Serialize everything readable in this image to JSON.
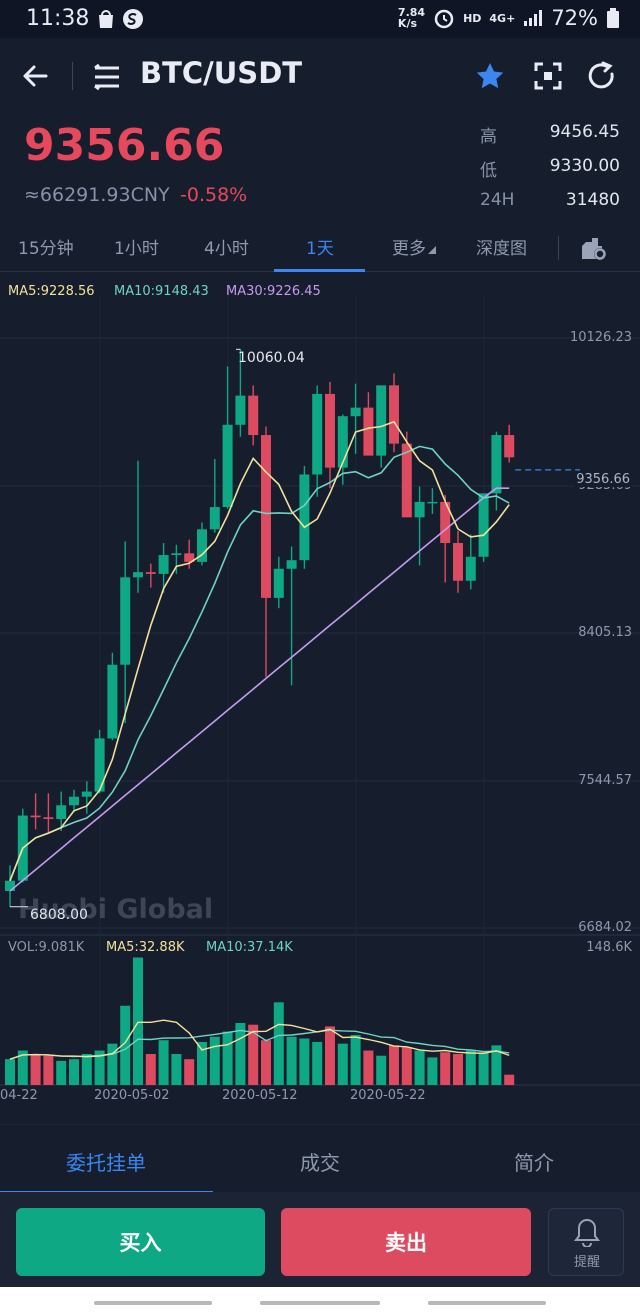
{
  "status": {
    "time": "11:38",
    "net_speed_top": "7.84",
    "net_speed_bot": "K/s",
    "hd": "HD",
    "net_type": "4G+",
    "battery": "72%"
  },
  "nav": {
    "title": "BTC/USDT"
  },
  "price": {
    "last": "9356.66",
    "cny": "≈66291.93CNY",
    "change": "-0.58%",
    "high_label": "高",
    "high": "9456.45",
    "low_label": "低",
    "low": "9330.00",
    "vol_label": "24H",
    "vol": "31480"
  },
  "tabs": [
    "15分钟",
    "1小时",
    "4小时",
    "1天",
    "更多",
    "深度图"
  ],
  "active_tab": "1天",
  "legend": {
    "ma5": "MA5:9228.56",
    "ma10": "MA10:9148.43",
    "ma30": "MA30:9226.45",
    "vol": "VOL:9.081K",
    "vma5": "MA5:32.88K",
    "vma10": "MA10:37.14K"
  },
  "axis": {
    "p1": "10126.23",
    "p2": "9285.69",
    "p3": "8405.13",
    "p4": "7544.57",
    "p5": "6684.02",
    "vmax": "148.6K",
    "price_tag": "9356.66",
    "hi_marker": "10060.04",
    "lo_marker": "6808.00"
  },
  "dates": [
    "04-22",
    "2020-05-02",
    "2020-05-12",
    "2020-05-22"
  ],
  "watermark": "Huobi Global",
  "colors": {
    "up": "#0fa884",
    "down": "#dc4b5f",
    "ma5": "#f1e19a",
    "ma10": "#6fd3c4",
    "ma30": "#c59af0",
    "accent": "#3b86ef"
  },
  "chart_data": {
    "type": "candlestick",
    "x": [
      "2020-04-20",
      "2020-04-21",
      "2020-04-22",
      "2020-04-23",
      "2020-04-24",
      "2020-04-25",
      "2020-04-26",
      "2020-04-27",
      "2020-04-28",
      "2020-04-29",
      "2020-04-30",
      "2020-05-01",
      "2020-05-02",
      "2020-05-03",
      "2020-05-04",
      "2020-05-05",
      "2020-05-06",
      "2020-05-07",
      "2020-05-08",
      "2020-05-09",
      "2020-05-10",
      "2020-05-11",
      "2020-05-12",
      "2020-05-13",
      "2020-05-14",
      "2020-05-15",
      "2020-05-16",
      "2020-05-17",
      "2020-05-18",
      "2020-05-19",
      "2020-05-20",
      "2020-05-21",
      "2020-05-22",
      "2020-05-23",
      "2020-05-24",
      "2020-05-25",
      "2020-05-26",
      "2020-05-27",
      "2020-05-28",
      "2020-05-29"
    ],
    "ohlc": [
      [
        6900,
        7050,
        6808,
        6960
      ],
      [
        6960,
        7380,
        6950,
        7340
      ],
      [
        7340,
        7470,
        7260,
        7330
      ],
      [
        7330,
        7470,
        7240,
        7320
      ],
      [
        7320,
        7480,
        7250,
        7400
      ],
      [
        7400,
        7490,
        7360,
        7450
      ],
      [
        7450,
        7540,
        7350,
        7480
      ],
      [
        7480,
        7840,
        7470,
        7790
      ],
      [
        7790,
        8290,
        7780,
        8220
      ],
      [
        8220,
        8940,
        7880,
        8730
      ],
      [
        8730,
        9410,
        8640,
        8760
      ],
      [
        8760,
        8810,
        8670,
        8750
      ],
      [
        8750,
        8930,
        8640,
        8860
      ],
      [
        8860,
        8920,
        8750,
        8870
      ],
      [
        8870,
        8950,
        8780,
        8820
      ],
      [
        8820,
        9050,
        8800,
        9010
      ],
      [
        9010,
        9420,
        8990,
        9140
      ],
      [
        9140,
        9960,
        9130,
        9620
      ],
      [
        9620,
        10060,
        9550,
        9790
      ],
      [
        9790,
        9850,
        9500,
        9560
      ],
      [
        9560,
        9610,
        8150,
        8610
      ],
      [
        8610,
        8850,
        8550,
        8780
      ],
      [
        8780,
        8910,
        8100,
        8830
      ],
      [
        8830,
        9380,
        8780,
        9330
      ],
      [
        9330,
        9850,
        9200,
        9800
      ],
      [
        9800,
        9870,
        9250,
        9370
      ],
      [
        9370,
        9680,
        9270,
        9670
      ],
      [
        9670,
        9860,
        9450,
        9720
      ],
      [
        9720,
        9810,
        9500,
        9440
      ],
      [
        9440,
        9830,
        9370,
        9850
      ],
      [
        9850,
        9920,
        9460,
        9510
      ],
      [
        9510,
        9580,
        9080,
        9080
      ],
      [
        9080,
        9260,
        8800,
        9170
      ],
      [
        9170,
        9250,
        9100,
        9170
      ],
      [
        9170,
        9210,
        8700,
        8930
      ],
      [
        8930,
        9000,
        8640,
        8710
      ],
      [
        8710,
        8980,
        8660,
        8850
      ],
      [
        8850,
        9200,
        8820,
        9220
      ],
      [
        9220,
        9580,
        9120,
        9560
      ],
      [
        9560,
        9620,
        9400,
        9430
      ]
    ],
    "volume": [
      30,
      40,
      36,
      34,
      28,
      30,
      36,
      40,
      48,
      92,
      148,
      36,
      52,
      36,
      30,
      50,
      56,
      62,
      72,
      70,
      52,
      96,
      56,
      54,
      50,
      68,
      48,
      58,
      40,
      34,
      46,
      44,
      40,
      32,
      38,
      36,
      40,
      38,
      46,
      12
    ],
    "ylim": [
      6684.02,
      10126.23
    ],
    "vol_max": 148.6
  }
}
